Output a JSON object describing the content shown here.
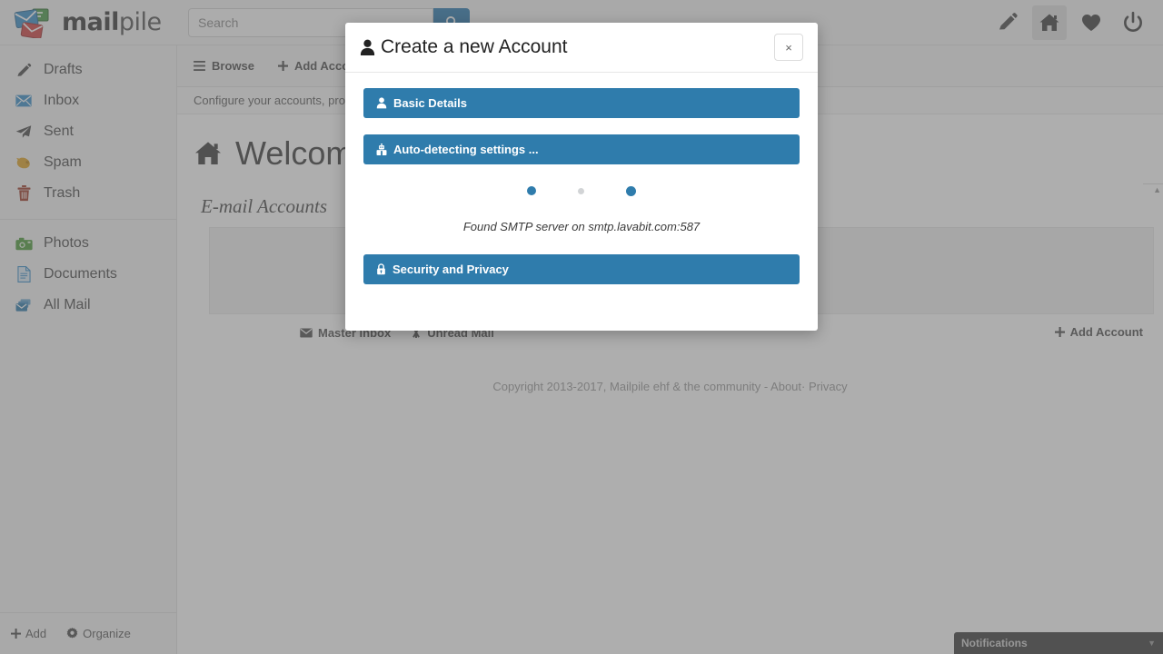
{
  "brand": {
    "name_bold": "mail",
    "name_light": "pile",
    "logo_icon": "mailpile-envelopes-logo"
  },
  "search": {
    "placeholder": "Search",
    "value": "",
    "button_icon": "search-icon"
  },
  "topbar_icons": [
    {
      "name": "compose-icon",
      "glyph": "pencil",
      "active": false
    },
    {
      "name": "home-icon",
      "glyph": "home",
      "active": true
    },
    {
      "name": "favorites-icon",
      "glyph": "heart",
      "active": false
    },
    {
      "name": "power-icon",
      "glyph": "power",
      "active": false
    }
  ],
  "sidebar": {
    "groups": [
      [
        {
          "label": "Drafts",
          "icon": "pencil-icon"
        },
        {
          "label": "Inbox",
          "icon": "envelope-icon"
        },
        {
          "label": "Sent",
          "icon": "paper-plane-icon"
        },
        {
          "label": "Spam",
          "icon": "pig-icon"
        },
        {
          "label": "Trash",
          "icon": "trash-icon"
        }
      ],
      [
        {
          "label": "Photos",
          "icon": "camera-icon"
        },
        {
          "label": "Documents",
          "icon": "document-icon"
        },
        {
          "label": "All Mail",
          "icon": "all-mail-icon"
        }
      ]
    ],
    "footer": {
      "add_label": "Add",
      "add_icon": "plus-icon",
      "organize_label": "Organize",
      "organize_icon": "gear-icon"
    }
  },
  "subnav": {
    "items": [
      {
        "label": "Browse",
        "icon": "list-icon"
      },
      {
        "label": "Add Account",
        "icon": "plus-icon"
      }
    ]
  },
  "description": "Configure your accounts, profiles and settings",
  "main": {
    "welcome_title": "Welcome",
    "welcome_icon": "home-icon",
    "section_title": "E-mail Accounts",
    "accounts_footer": {
      "master_inbox": {
        "label": "Master Inbox",
        "icon": "envelope-icon"
      },
      "unread_mail": {
        "label": "Unread Mail",
        "icon": "asterisk-icon"
      },
      "add_account": {
        "label": "Add Account",
        "icon": "plus-icon"
      }
    },
    "copyright": "Copyright 2013-2017, Mailpile ehf & the community - About· Privacy"
  },
  "notifications": {
    "label": "Notifications",
    "caret_icon": "chevron-down-icon"
  },
  "scrollbar": {
    "up_arrow_icon": "chevron-up-icon"
  },
  "modal": {
    "title": "Create a new Account",
    "title_icon": "user-icon",
    "close_label": "×",
    "close_icon": "close-icon",
    "steps": [
      {
        "label": "Basic Details",
        "icon": "user-icon",
        "state": "done"
      },
      {
        "label": "Auto-detecting settings ...",
        "icon": "robot-icon",
        "state": "active"
      },
      {
        "label": "Security and Privacy",
        "icon": "lock-icon",
        "state": "pending"
      }
    ],
    "progress_dots": [
      {
        "color": "#2f7cac",
        "size": 10
      },
      {
        "color": "#d2d4d6",
        "size": 7
      },
      {
        "color": "#2f7cac",
        "size": 11
      }
    ],
    "status_text": "Found SMTP server on smtp.lavabit.com:587"
  },
  "colors": {
    "accent_blue": "#2f7cac",
    "dot_active": "#2f7cac",
    "dot_inactive": "#d2d4d6",
    "chrome_bg": "#f4f4f4",
    "overlay": "rgba(100,100,100,0.52)"
  }
}
